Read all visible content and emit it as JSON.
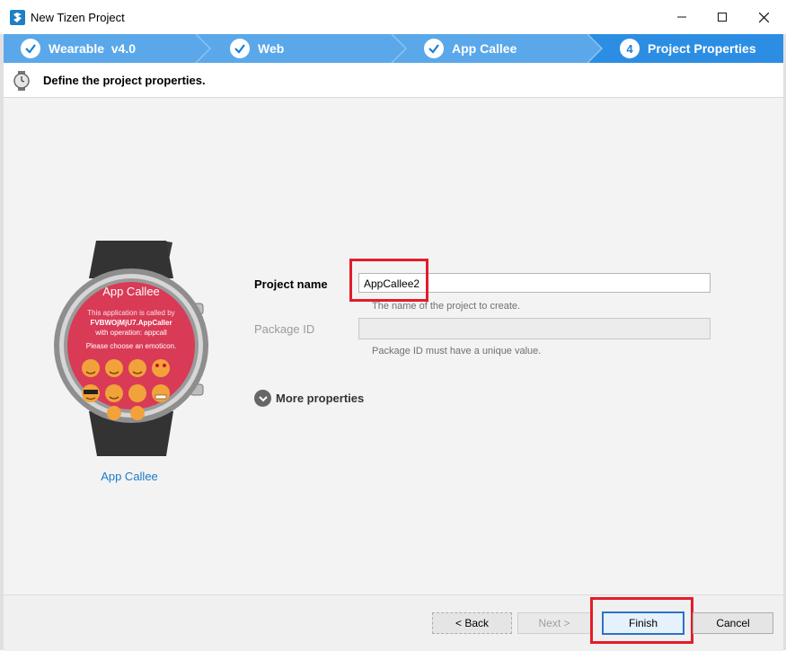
{
  "window": {
    "title": "New Tizen Project"
  },
  "steps": [
    {
      "label": "Wearable  v4.0",
      "state": "done"
    },
    {
      "label": "Web",
      "state": "done"
    },
    {
      "label": "App Callee",
      "state": "done"
    },
    {
      "label": "Project Properties",
      "state": "current",
      "number": "4"
    }
  ],
  "header": {
    "text": "Define the project properties."
  },
  "preview": {
    "app_title": "App Callee",
    "message_line1": "This application is called by",
    "message_line2": "FVBWOjMjU7.AppCaller",
    "message_line3": "with operation: appcall",
    "prompt": "Please choose an emoticon.",
    "caption": "App Callee"
  },
  "form": {
    "project_name_label": "Project name",
    "project_name_value": "AppCallee2",
    "project_name_hint": "The name of the project to create.",
    "package_id_label": "Package ID",
    "package_id_value": "",
    "package_id_hint": "Package ID must have a unique value.",
    "more_properties_label": "More properties"
  },
  "footer": {
    "back_label": "< Back",
    "next_label": "Next >",
    "finish_label": "Finish",
    "cancel_label": "Cancel"
  },
  "colors": {
    "steps_bg": "#5aa8ea",
    "steps_active": "#2c8ee3",
    "highlight": "#e41c2a",
    "watch_face": "#d93a56"
  }
}
